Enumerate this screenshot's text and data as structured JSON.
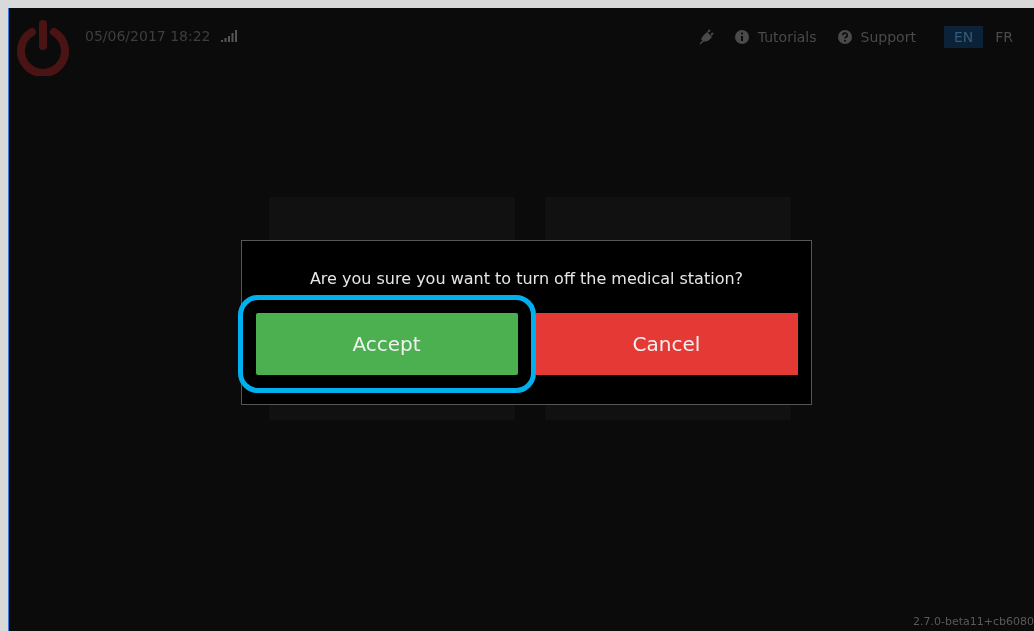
{
  "header": {
    "datetime": "05/06/2017 18:22",
    "links": [
      {
        "label": "Tutorials",
        "kind": "info"
      },
      {
        "label": "Support",
        "kind": "help"
      }
    ],
    "languages": [
      {
        "label": "EN",
        "selected": true
      },
      {
        "label": "FR",
        "selected": false
      }
    ]
  },
  "dialog": {
    "message": "Are you sure you want to turn off the medical station?",
    "buttons": [
      {
        "label": "Accept",
        "kind": "accept",
        "focused": true
      },
      {
        "label": "Cancel",
        "kind": "cancel",
        "focused": false
      }
    ]
  },
  "version": "2.7.0-beta11+cb6080"
}
